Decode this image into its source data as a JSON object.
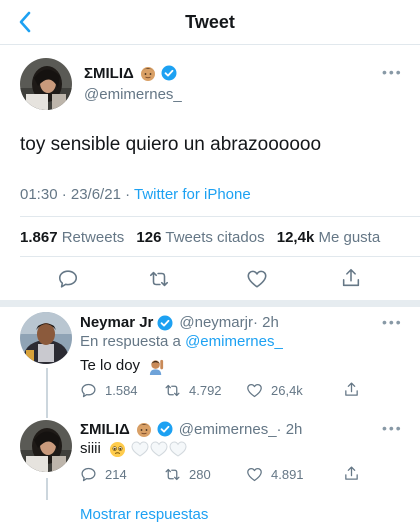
{
  "header": {
    "title": "Tweet"
  },
  "colors": {
    "accent": "#1da1f2",
    "secondary_text": "#657786",
    "divider": "#e1e8ed"
  },
  "main_tweet": {
    "name": "ΣMILIΔ",
    "handle": "@emimernes_",
    "text": "toy sensible quiero un abrazoooooo",
    "time": "01:30 · 23/6/21 · ",
    "source": "Twitter for iPhone",
    "stats": {
      "retweets_count": "1.867",
      "retweets_label": "Retweets",
      "quotes_count": "126",
      "quotes_label": "Tweets citados",
      "likes_count": "12,4k",
      "likes_label": "Me gusta"
    },
    "actions": [
      "reply-icon",
      "retweet-icon",
      "like-icon",
      "share-icon"
    ]
  },
  "replies": [
    {
      "name": "Neymar Jr",
      "handle": "@neymarjr",
      "time": " · 2h",
      "in_reply_prefix": "En respuesta a ",
      "in_reply_handle": "@emimernes_",
      "text": "Te lo doy",
      "emoji": "person-raising-hand-emoji",
      "replies_count": "1.584",
      "retweets_count": "4.792",
      "likes_count": "26,4k"
    },
    {
      "name": "ΣMILIΔ",
      "handle": "@emimernes_",
      "time": " · 2h",
      "text": "siiii",
      "emoji": "pleading-face-emoji",
      "replies_count": "214",
      "retweets_count": "280",
      "likes_count": "4.891"
    }
  ],
  "show_replies": "Mostrar respuestas"
}
